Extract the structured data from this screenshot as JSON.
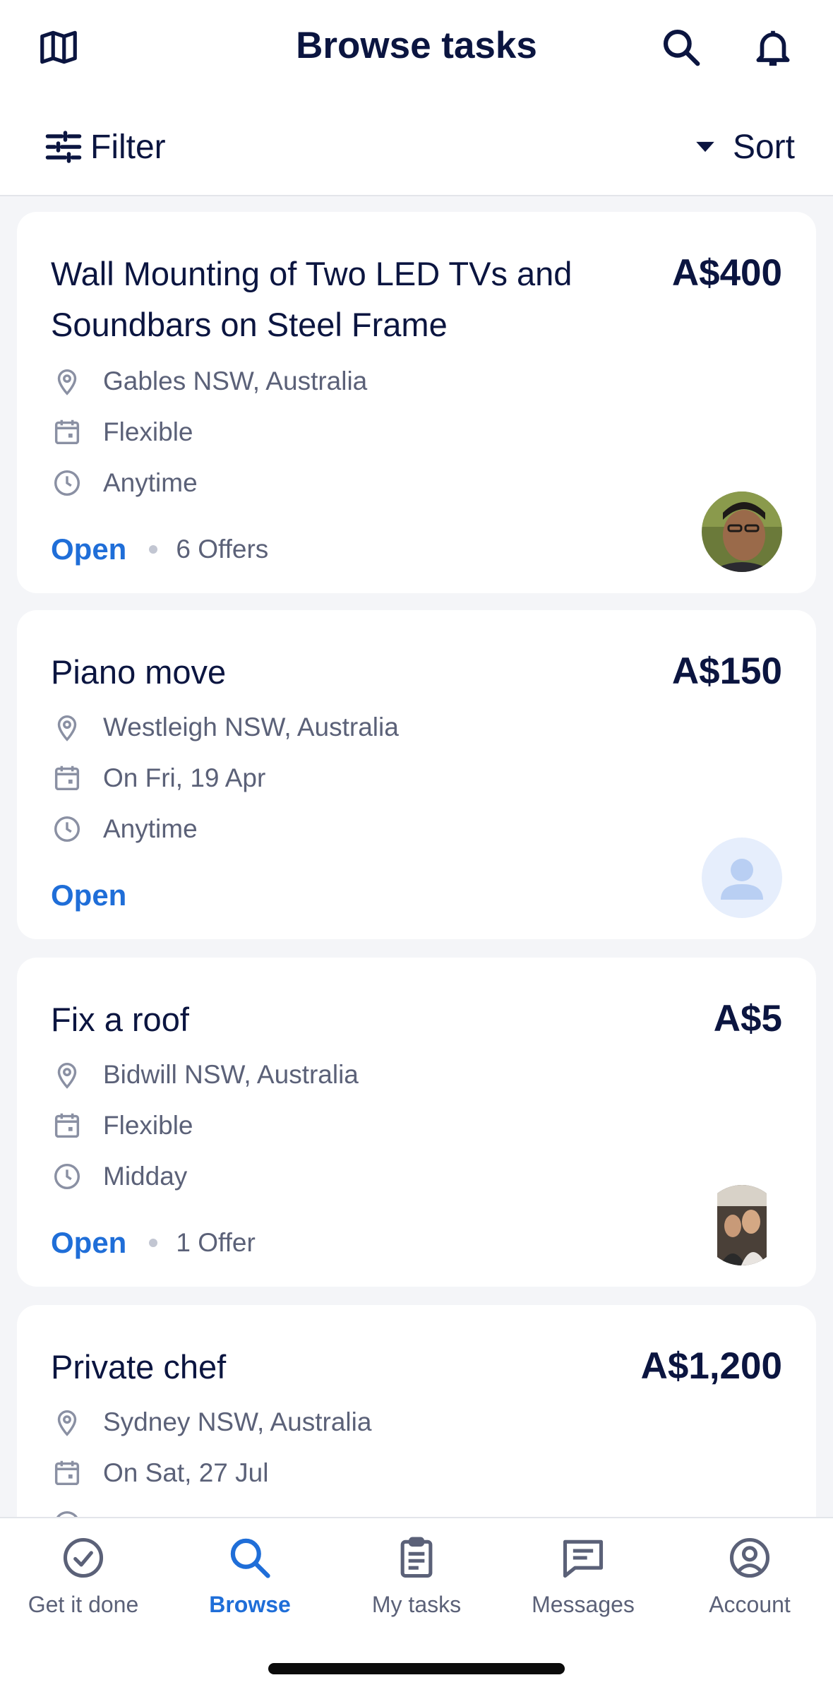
{
  "header": {
    "title": "Browse tasks",
    "icons": [
      "map-icon",
      "search-icon",
      "bell-icon"
    ]
  },
  "toolbar": {
    "filter_label": "Filter",
    "sort_label": "Sort"
  },
  "tasks": [
    {
      "title": "Wall Mounting of Two LED TVs and Soundbars on Steel Frame",
      "price": "A$400",
      "location": "Gables NSW, Australia",
      "date": "Flexible",
      "time": "Anytime",
      "status": "Open",
      "offers": "6 Offers",
      "avatar": "photo"
    },
    {
      "title": "Piano move",
      "price": "A$150",
      "location": "Westleigh NSW, Australia",
      "date": "On Fri, 19 Apr",
      "time": "Anytime",
      "status": "Open",
      "offers": "",
      "avatar": "placeholder"
    },
    {
      "title": "Fix a roof",
      "price": "A$5",
      "location": "Bidwill NSW, Australia",
      "date": "Flexible",
      "time": "Midday",
      "status": "Open",
      "offers": "1 Offer",
      "avatar": "photo"
    },
    {
      "title": "Private chef",
      "price": "A$1,200",
      "location": "Sydney NSW, Australia",
      "date": "On Sat, 27 Jul"
    }
  ],
  "nav": [
    {
      "label": "Get it done",
      "icon": "check-circle-icon"
    },
    {
      "label": "Browse",
      "icon": "search-icon",
      "active": true
    },
    {
      "label": "My tasks",
      "icon": "clipboard-icon"
    },
    {
      "label": "Messages",
      "icon": "message-icon"
    },
    {
      "label": "Account",
      "icon": "account-icon"
    }
  ],
  "colors": {
    "accent": "#1f6ed8",
    "text": "#0b1540",
    "muted": "#5b6178",
    "background": "#f4f5f8"
  }
}
